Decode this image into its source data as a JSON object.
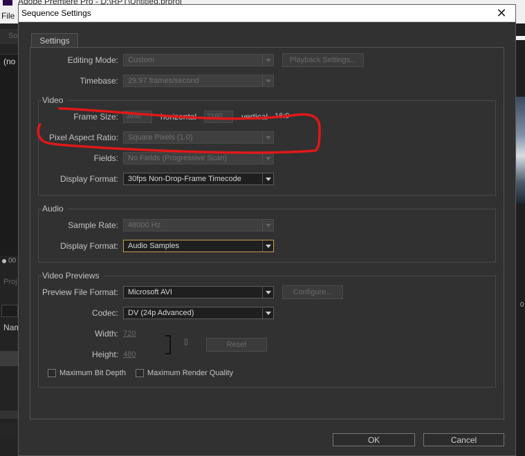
{
  "app": {
    "title": "Adobe Premiere Pro - D:\\RPT\\Untitled.prproj",
    "menu_file": "File",
    "left_panel_text": "(no",
    "left_timecode": "00",
    "left_project_tab": "Proj",
    "left_name_header": "Nam",
    "right_timecode": "0"
  },
  "dialog": {
    "title": "Sequence Settings",
    "close_symbol": "✕",
    "tab": "Settings",
    "editing_mode": {
      "label": "Editing Mode:",
      "value": "Custom"
    },
    "playback_settings": "Playback Settings...",
    "timebase": {
      "label": "Timebase:",
      "value": "29.97 frames/second"
    },
    "video": {
      "title": "Video",
      "frame_size_label": "Frame Size:",
      "frame_width": "3840",
      "horizontal": "horizontal",
      "frame_height": "2160",
      "vertical": "vertical",
      "aspect": "16:9",
      "pixel_aspect_label": "Pixel Aspect Ratio:",
      "pixel_aspect_value": "Square Pixels (1.0)",
      "fields_label": "Fields:",
      "fields_value": "No Fields (Progressive Scan)",
      "display_format_label": "Display Format:",
      "display_format_value": "30fps Non-Drop-Frame Timecode"
    },
    "audio": {
      "title": "Audio",
      "sample_rate_label": "Sample Rate:",
      "sample_rate_value": "48000 Hz",
      "display_format_label": "Display Format:",
      "display_format_value": "Audio Samples"
    },
    "previews": {
      "title": "Video Previews",
      "file_format_label": "Preview File Format:",
      "file_format_value": "Microsoft AVI",
      "configure": "Configure...",
      "codec_label": "Codec:",
      "codec_value": "DV (24p Advanced)",
      "width_label": "Width:",
      "width_value": "720",
      "height_label": "Height:",
      "height_value": "480",
      "reset": "Reset",
      "max_bit_depth": "Maximum Bit Depth",
      "max_render_quality": "Maximum Render Quality"
    },
    "ok": "OK",
    "cancel": "Cancel"
  },
  "colors": {
    "dialog_bg": "#313131",
    "focus_border": "#c8a050",
    "annotation_red": "#e11818"
  }
}
